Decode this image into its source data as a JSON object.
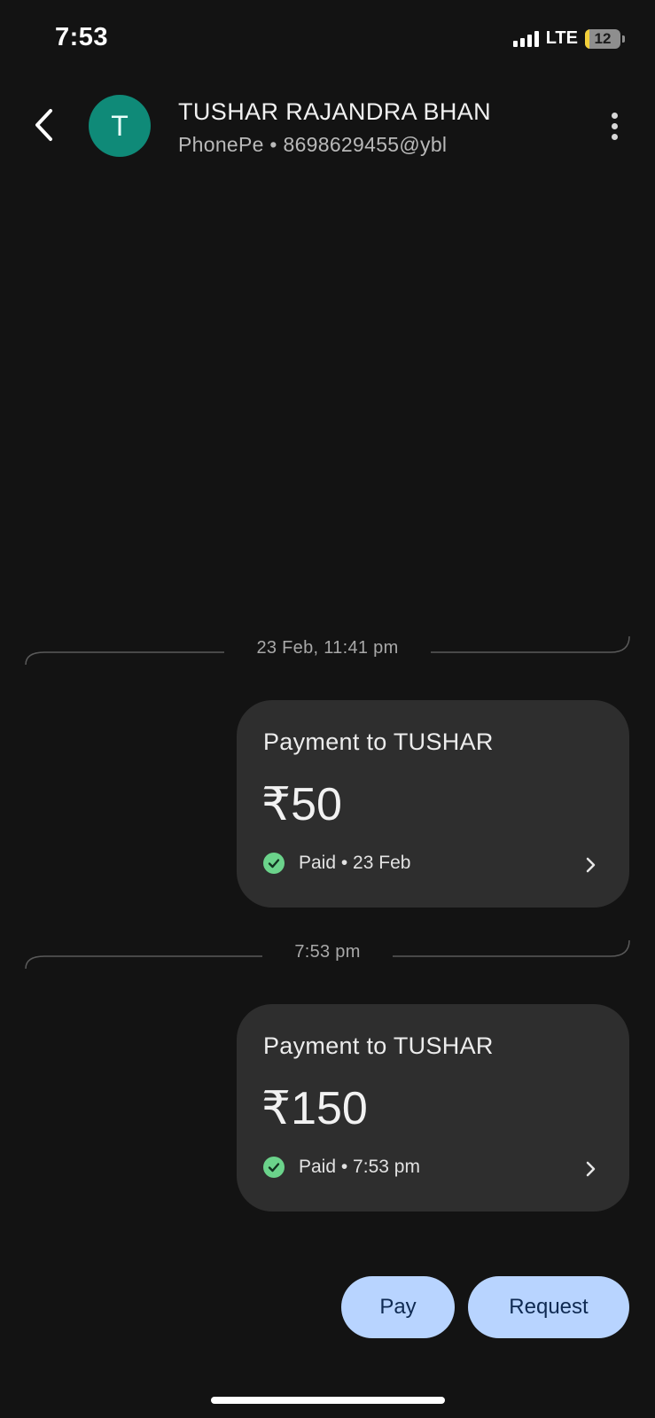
{
  "status_bar": {
    "time": "7:53",
    "network": "LTE",
    "battery_level": "12",
    "battery_fraction": 0.12,
    "battery_color": "#f2cf3a"
  },
  "header": {
    "back_icon": "chevron-left-icon",
    "avatar_letter": "T",
    "avatar_color": "#0f8a78",
    "contact_name": "TUSHAR RAJANDRA BHAN",
    "contact_subtitle": "PhonePe • 8698629455@ybl",
    "menu_icon": "more-vertical-icon"
  },
  "conversation": {
    "separators": [
      {
        "label": "23 Feb, 11:41 pm"
      },
      {
        "label": "7:53 pm"
      }
    ],
    "payments": [
      {
        "title": "Payment to TUSHAR",
        "amount": "₹50",
        "status": "Paid • 23 Feb",
        "status_icon": "check-circle-icon",
        "status_color": "#6bd38b"
      },
      {
        "title": "Payment to TUSHAR",
        "amount": "₹150",
        "status": "Paid • 7:53 pm",
        "status_icon": "check-circle-icon",
        "status_color": "#6bd38b"
      }
    ]
  },
  "actions": {
    "pay_label": "Pay",
    "request_label": "Request",
    "button_color": "#b8d4ff"
  }
}
